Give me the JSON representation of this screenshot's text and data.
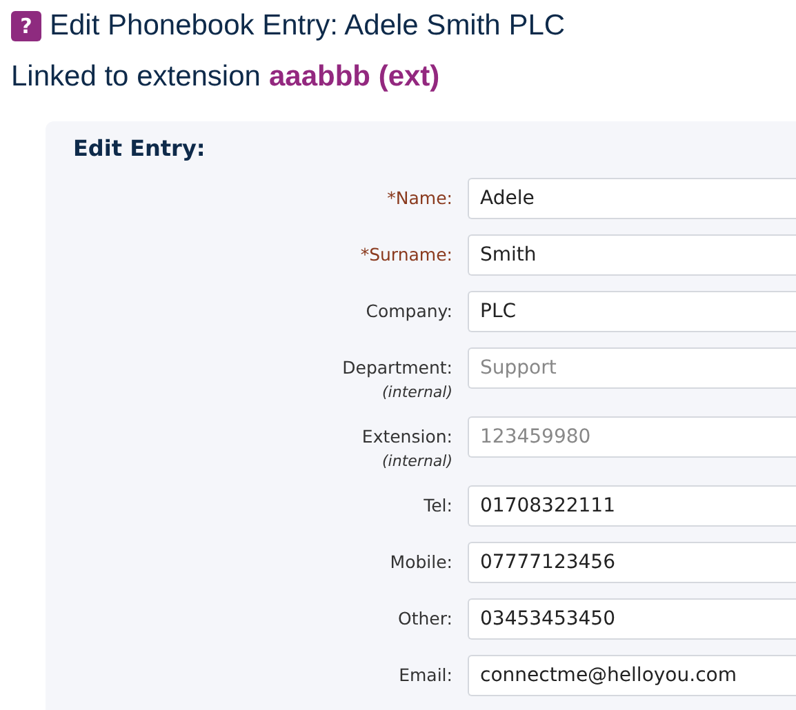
{
  "title": {
    "help_icon": "?",
    "text": "Edit Phonebook Entry: Adele Smith PLC"
  },
  "subtitle": {
    "text": "Linked to extension",
    "link": "aaabbb (ext)"
  },
  "form": {
    "heading": "Edit Entry:",
    "fields": [
      {
        "label": "*Name:",
        "required": true,
        "value": "Adele",
        "disabled": false
      },
      {
        "label": "*Surname:",
        "required": true,
        "value": "Smith",
        "disabled": false
      },
      {
        "label": "Company:",
        "required": false,
        "value": "PLC",
        "disabled": false
      },
      {
        "label": "Department:",
        "note": "(internal)",
        "required": false,
        "value": "Support",
        "disabled": true
      },
      {
        "label": "Extension:",
        "note": "(internal)",
        "required": false,
        "value": "123459980",
        "disabled": true
      },
      {
        "label": "Tel:",
        "required": false,
        "value": "01708322111",
        "disabled": false
      },
      {
        "label": "Mobile:",
        "required": false,
        "value": "07777123456",
        "disabled": false
      },
      {
        "label": "Other:",
        "required": false,
        "value": "03453453450",
        "disabled": false
      },
      {
        "label": "Email:",
        "required": false,
        "value": "connectme@helloyou.com",
        "disabled": false
      }
    ]
  }
}
